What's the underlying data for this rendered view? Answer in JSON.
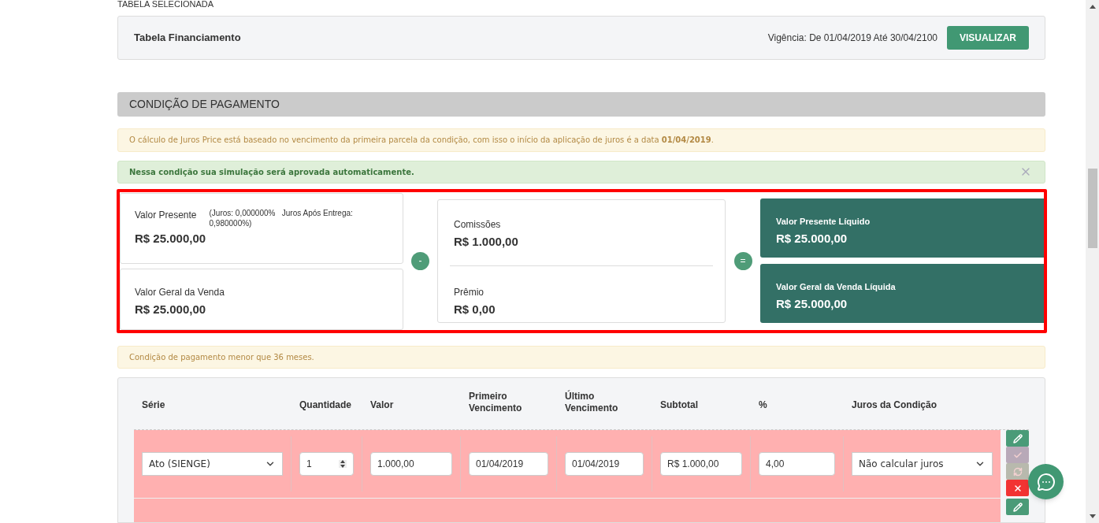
{
  "selected_table": {
    "section_label": "TABELA SELECIONADA",
    "name": "Tabela Financiamento",
    "validity": "Vigência: De 01/04/2019 Até 30/04/2100",
    "button": "VISUALIZAR"
  },
  "payment_condition": {
    "header": "CONDIÇÃO DE PAGAMENTO",
    "alerts": [
      {
        "kind": "warning",
        "text": "O cálculo de Juros Price está baseado no vencimento da primeira parcela da condição, com isso o início da aplicação de juros é a data **01/04/2019**.",
        "closable": false
      },
      {
        "kind": "success",
        "text": "Nessa condição sua simulação será aprovada automaticamente.",
        "closable": true
      }
    ],
    "summary": {
      "present_value": {
        "label": "Valor Presente",
        "note": "(Juros: 0,000000%   Juros Após Entrega: 0,980000%)",
        "value": "R$ 25.000,00"
      },
      "total_sale": {
        "label": "Valor Geral da Venda",
        "value": "R$ 25.000,00"
      },
      "minus_sign": "-",
      "deductions": [
        {
          "label": "Comissões",
          "value": "R$ 1.000,00"
        },
        {
          "label": "Prêmio",
          "value": "R$ 0,00"
        }
      ],
      "equals_sign": "=",
      "results": [
        {
          "label": "Valor Presente Líquido",
          "value": "R$ 25.000,00"
        },
        {
          "label": "Valor Geral da Venda Líquida",
          "value": "R$ 25.000,00"
        }
      ]
    },
    "notice": "Condição de pagamento menor que 36 meses."
  },
  "table": {
    "columns": [
      "Série",
      "Quantidade",
      "Valor",
      "Primeiro Vencimento",
      "Último Vencimento",
      "Subtotal",
      "%",
      "Juros da Condição"
    ],
    "rows": [
      {
        "cells": [
          {
            "kind": "select",
            "value": "Ato (SIENGE)"
          },
          {
            "kind": "number",
            "value": "1"
          },
          {
            "kind": "text",
            "value": "1.000,00"
          },
          {
            "kind": "text",
            "value": "01/04/2019"
          },
          {
            "kind": "text",
            "value": "01/04/2019"
          },
          {
            "kind": "text",
            "value": "R$ 1.000,00"
          },
          {
            "kind": "text",
            "value": "4,00"
          },
          {
            "kind": "select",
            "value": "Não calcular juros"
          }
        ],
        "actions": [
          {
            "kind": "edit",
            "disabled": false
          },
          {
            "kind": "confirm",
            "disabled": true
          },
          {
            "kind": "refresh",
            "disabled": true
          },
          {
            "kind": "delete",
            "disabled": false
          }
        ]
      },
      {
        "cells": [],
        "actions": [
          {
            "kind": "edit",
            "disabled": false
          }
        ]
      }
    ]
  }
}
